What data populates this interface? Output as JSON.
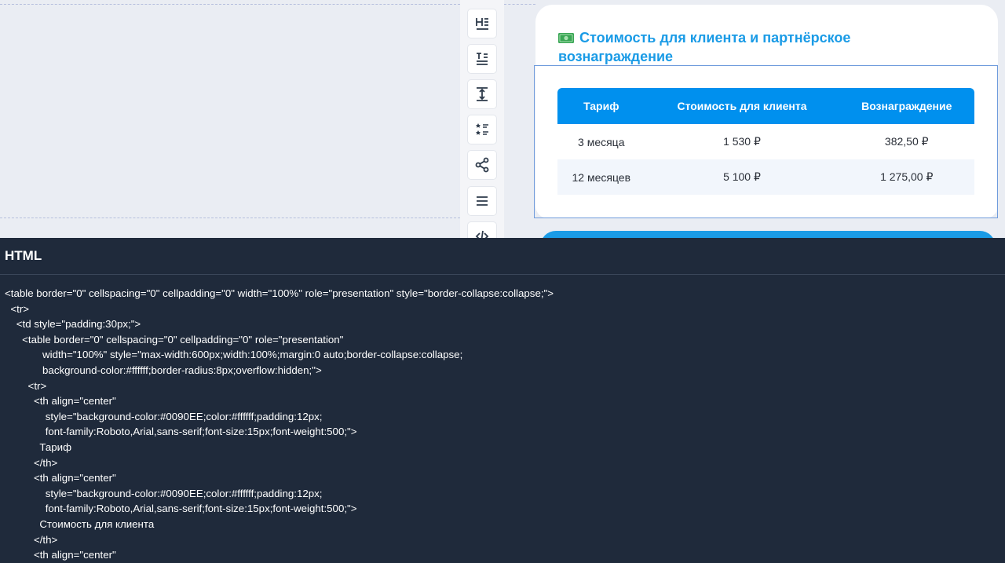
{
  "block": {
    "title": "Стоимость для клиента и партнёрское вознаграждение",
    "icon": "money-icon"
  },
  "tools": [
    {
      "icon": "heading-icon"
    },
    {
      "icon": "text-block-icon"
    },
    {
      "icon": "spacer-icon"
    },
    {
      "icon": "rating-list-icon"
    },
    {
      "icon": "share-icon"
    },
    {
      "icon": "menu-icon"
    },
    {
      "icon": "code-icon"
    }
  ],
  "table": {
    "headers": [
      "Тариф",
      "Стоимость для клиента",
      "Вознаграждение"
    ],
    "rows": [
      [
        "3 месяца",
        "1 530 ₽",
        "382,50 ₽"
      ],
      [
        "12 месяцев",
        "5 100 ₽",
        "1 275,00 ₽"
      ]
    ]
  },
  "colors": {
    "accent": "#0090EE",
    "title": "#1a9be6",
    "panel": "#1f2a3b"
  },
  "code_panel": {
    "title": "HTML",
    "lines": [
      "<table border=\"0\" cellspacing=\"0\" cellpadding=\"0\" width=\"100%\" role=\"presentation\" style=\"border-collapse:collapse;\">",
      "  <tr>",
      "    <td style=\"padding:30px;\">",
      "      <table border=\"0\" cellspacing=\"0\" cellpadding=\"0\" role=\"presentation\"",
      "             width=\"100%\" style=\"max-width:600px;width:100%;margin:0 auto;border-collapse:collapse;",
      "             background-color:#ffffff;border-radius:8px;overflow:hidden;\">",
      "        <tr>",
      "          <th align=\"center\"",
      "              style=\"background-color:#0090EE;color:#ffffff;padding:12px;",
      "              font-family:Roboto,Arial,sans-serif;font-size:15px;font-weight:500;\">",
      "            Тариф",
      "          </th>",
      "          <th align=\"center\"",
      "              style=\"background-color:#0090EE;color:#ffffff;padding:12px;",
      "              font-family:Roboto,Arial,sans-serif;font-size:15px;font-weight:500;\">",
      "            Стоимость для клиента",
      "          </th>",
      "          <th align=\"center\""
    ]
  }
}
